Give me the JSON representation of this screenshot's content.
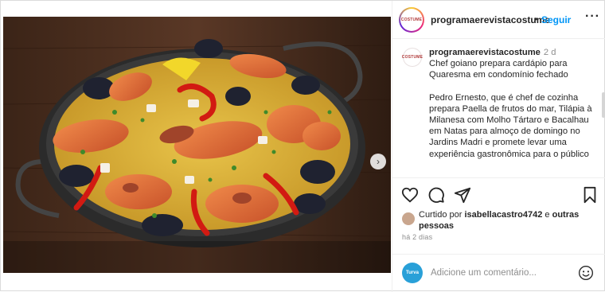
{
  "post": {
    "username": "programaerevistacostume",
    "avatar_text": "COSTUME",
    "follow_label": "Seguir",
    "separator": "•",
    "more_icon": "···"
  },
  "caption": {
    "username": "programaerevistacostume",
    "time": "2 d",
    "headline": "Chef goiano prepara cardápio para Quaresma em condomínio fechado",
    "body": "Pedro Ernesto, que é chef de cozinha prepara Paella de frutos do mar, Tilápia à Milanesa com Molho Tártaro e Bacalhau em Natas para almoço de domingo no Jardins Madri e promete levar uma experiência gastronômica para o público"
  },
  "likes": {
    "prefix": "Curtido por",
    "user": "isabellacastro4742",
    "connector": "e",
    "others": "outras pessoas"
  },
  "timestamp": "há 2 dias",
  "comment": {
    "avatar_text": "Turva",
    "placeholder": "Adicione um comentário..."
  },
  "icons": {
    "like": "heart-icon",
    "comment": "comment-icon",
    "share": "share-icon",
    "save": "bookmark-icon",
    "emoji": "emoji-icon",
    "next": "chevron-right-icon"
  },
  "colors": {
    "follow": "#0095f6",
    "muted": "#8e8e8e",
    "text": "#262626",
    "border": "#efefef"
  },
  "carousel": {
    "pages": 2,
    "current": 1
  }
}
